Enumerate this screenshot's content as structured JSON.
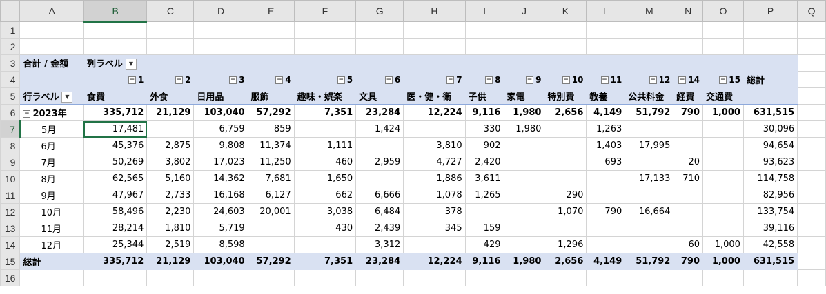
{
  "columns": [
    "A",
    "B",
    "C",
    "D",
    "E",
    "F",
    "G",
    "H",
    "I",
    "J",
    "K",
    "L",
    "M",
    "N",
    "O",
    "P",
    "Q"
  ],
  "row_numbers": [
    "1",
    "2",
    "3",
    "4",
    "5",
    "6",
    "7",
    "8",
    "9",
    "10",
    "11",
    "12",
    "13",
    "14",
    "15",
    "16"
  ],
  "pivot": {
    "value_field": "合計 / 金額",
    "col_label": "列ラベル",
    "row_label": "行ラベル",
    "col_indices": [
      "1",
      "2",
      "3",
      "4",
      "5",
      "6",
      "7",
      "8",
      "9",
      "10",
      "11",
      "12",
      "14",
      "15"
    ],
    "grand_total_col_header": "総計",
    "categories": [
      "食費",
      "外食",
      "日用品",
      "服飾",
      "趣味・娯楽",
      "文具",
      "医・健・衛",
      "子供",
      "家電",
      "特別費",
      "教養",
      "公共料金",
      "経費",
      "交通費"
    ],
    "year_row": {
      "label": "2023年",
      "values": [
        "335,712",
        "21,129",
        "103,040",
        "57,292",
        "7,351",
        "23,284",
        "12,224",
        "9,116",
        "1,980",
        "2,656",
        "4,149",
        "51,792",
        "790",
        "1,000",
        "631,515"
      ]
    },
    "months": [
      {
        "label": "5月",
        "values": [
          "17,481",
          "",
          "6,759",
          "859",
          "",
          "1,424",
          "",
          "330",
          "1,980",
          "",
          "1,263",
          "",
          "",
          "",
          "30,096"
        ]
      },
      {
        "label": "6月",
        "values": [
          "45,376",
          "2,875",
          "9,808",
          "11,374",
          "1,111",
          "",
          "3,810",
          "902",
          "",
          "",
          "1,403",
          "17,995",
          "",
          "",
          "94,654"
        ]
      },
      {
        "label": "7月",
        "values": [
          "50,269",
          "3,802",
          "17,023",
          "11,250",
          "460",
          "2,959",
          "4,727",
          "2,420",
          "",
          "",
          "693",
          "",
          "20",
          "",
          "93,623"
        ]
      },
      {
        "label": "8月",
        "values": [
          "62,565",
          "5,160",
          "14,362",
          "7,681",
          "1,650",
          "",
          "1,886",
          "3,611",
          "",
          "",
          "",
          "17,133",
          "710",
          "",
          "114,758"
        ]
      },
      {
        "label": "9月",
        "values": [
          "47,967",
          "2,733",
          "16,168",
          "6,127",
          "662",
          "6,666",
          "1,078",
          "1,265",
          "",
          "290",
          "",
          "",
          "",
          "",
          "82,956"
        ]
      },
      {
        "label": "10月",
        "values": [
          "58,496",
          "2,230",
          "24,603",
          "20,001",
          "3,038",
          "6,484",
          "378",
          "",
          "",
          "1,070",
          "790",
          "16,664",
          "",
          "",
          "133,754"
        ]
      },
      {
        "label": "11月",
        "values": [
          "28,214",
          "1,810",
          "5,719",
          "",
          "430",
          "2,439",
          "345",
          "159",
          "",
          "",
          "",
          "",
          "",
          "",
          "39,116"
        ]
      },
      {
        "label": "12月",
        "values": [
          "25,344",
          "2,519",
          "8,598",
          "",
          "",
          "3,312",
          "",
          "429",
          "",
          "1,296",
          "",
          "",
          "60",
          "1,000",
          "42,558"
        ]
      }
    ],
    "total_row": {
      "label": "総計",
      "values": [
        "335,712",
        "21,129",
        "103,040",
        "57,292",
        "7,351",
        "23,284",
        "12,224",
        "9,116",
        "1,980",
        "2,656",
        "4,149",
        "51,792",
        "790",
        "1,000",
        "631,515"
      ]
    }
  },
  "icons": {
    "collapse": "minus-box-icon",
    "filter": "filter-dropdown-icon",
    "dropdown": "dropdown-arrow-icon"
  },
  "colors": {
    "pivot_header_bg": "#d9e1f2",
    "selection": "#217346"
  }
}
